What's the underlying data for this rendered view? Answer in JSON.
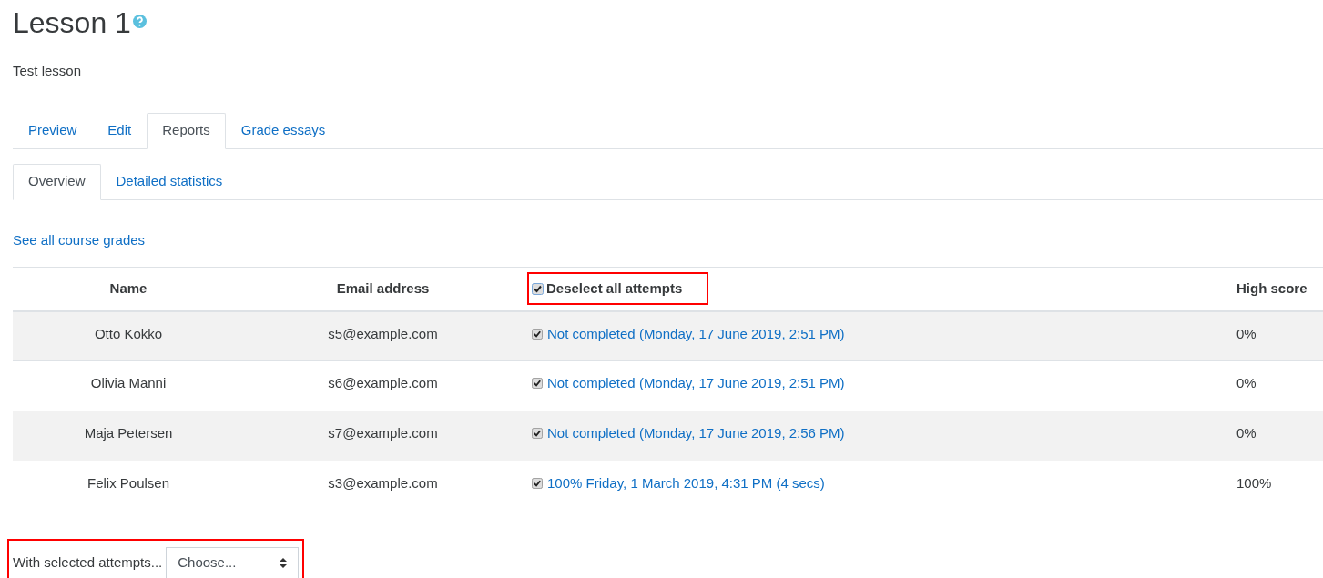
{
  "title": "Lesson 1",
  "description": "Test lesson",
  "tabs": [
    {
      "label": "Preview",
      "selected": false
    },
    {
      "label": "Edit",
      "selected": false
    },
    {
      "label": "Reports",
      "selected": true
    },
    {
      "label": "Grade essays",
      "selected": false
    }
  ],
  "subtabs": [
    {
      "label": "Overview",
      "selected": true
    },
    {
      "label": "Detailed statistics",
      "selected": false
    }
  ],
  "grades_link": "See all course grades",
  "table": {
    "columns": [
      "Name",
      "Email address",
      "Deselect all attempts",
      "High score"
    ],
    "select_all_checked": true,
    "rows": [
      {
        "name": "Otto Kokko",
        "email": "s5@example.com",
        "checked": true,
        "attempt": "Not completed (Monday, 17 June 2019, 2:51 PM)",
        "high_score": "0%"
      },
      {
        "name": "Olivia Manni",
        "email": "s6@example.com",
        "checked": true,
        "attempt": "Not completed (Monday, 17 June 2019, 2:51 PM)",
        "high_score": "0%"
      },
      {
        "name": "Maja Petersen",
        "email": "s7@example.com",
        "checked": true,
        "attempt": "Not completed (Monday, 17 June 2019, 2:56 PM)",
        "high_score": "0%"
      },
      {
        "name": "Felix Poulsen",
        "email": "s3@example.com",
        "checked": true,
        "attempt": "100% Friday, 1 March 2019, 4:31 PM (4 secs)",
        "high_score": "100%"
      }
    ]
  },
  "bulk_action": {
    "label": "With selected attempts...",
    "placeholder": "Choose..."
  }
}
